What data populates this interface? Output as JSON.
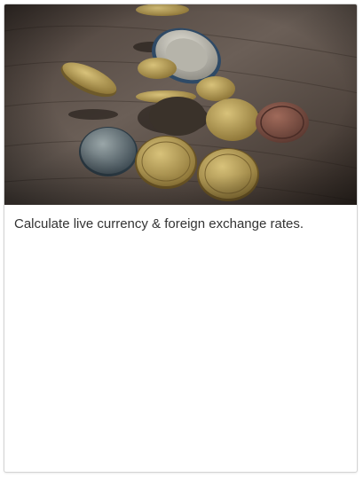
{
  "card": {
    "image_subject": "coins-photo",
    "description": "Calculate live currency & foreign exchange rates."
  },
  "colors": {
    "card_border": "#d4d4d4",
    "text": "#333333",
    "wood_dark": "#2b2420",
    "wood_light": "#6b5f57",
    "coin_gold": "#b49a52",
    "coin_silver": "#c9c7bd",
    "coin_copper": "#7a4f43"
  }
}
